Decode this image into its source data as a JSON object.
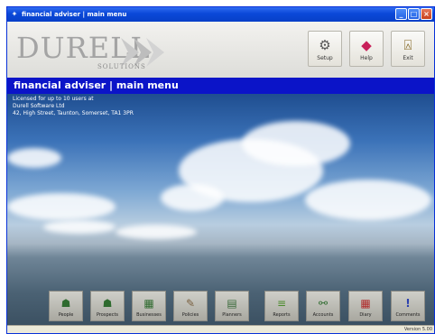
{
  "window": {
    "title": "financial adviser | main menu"
  },
  "header": {
    "logo_main": "DURELL",
    "logo_sub": "SOLUTIONS",
    "buttons": [
      {
        "label": "Setup",
        "icon": "setup-icon"
      },
      {
        "label": "Help",
        "icon": "help-icon"
      },
      {
        "label": "Exit",
        "icon": "exit-icon"
      }
    ]
  },
  "banner": {
    "title": "financial adviser | main menu"
  },
  "licence": {
    "line1": "Licensed for up to 10 users at",
    "line2": "Durell Software Ltd",
    "line3": "42, High Street, Taunton, Somerset, TA1 3PR"
  },
  "dock": {
    "items": [
      {
        "label": "People",
        "icon": "people-icon"
      },
      {
        "label": "Prospects",
        "icon": "prospects-icon"
      },
      {
        "label": "Businesses",
        "icon": "businesses-icon"
      },
      {
        "label": "Policies",
        "icon": "policies-icon"
      },
      {
        "label": "Planners",
        "icon": "planners-icon"
      },
      {
        "label": "Reports",
        "icon": "reports-icon"
      },
      {
        "label": "Accounts",
        "icon": "accounts-icon"
      },
      {
        "label": "Diary",
        "icon": "diary-icon"
      },
      {
        "label": "Comments",
        "icon": "comments-icon"
      }
    ]
  },
  "status": {
    "version": "Version 5.00"
  },
  "colors": {
    "titlebar": "#0a48d8",
    "banner": "#0b14c8"
  }
}
